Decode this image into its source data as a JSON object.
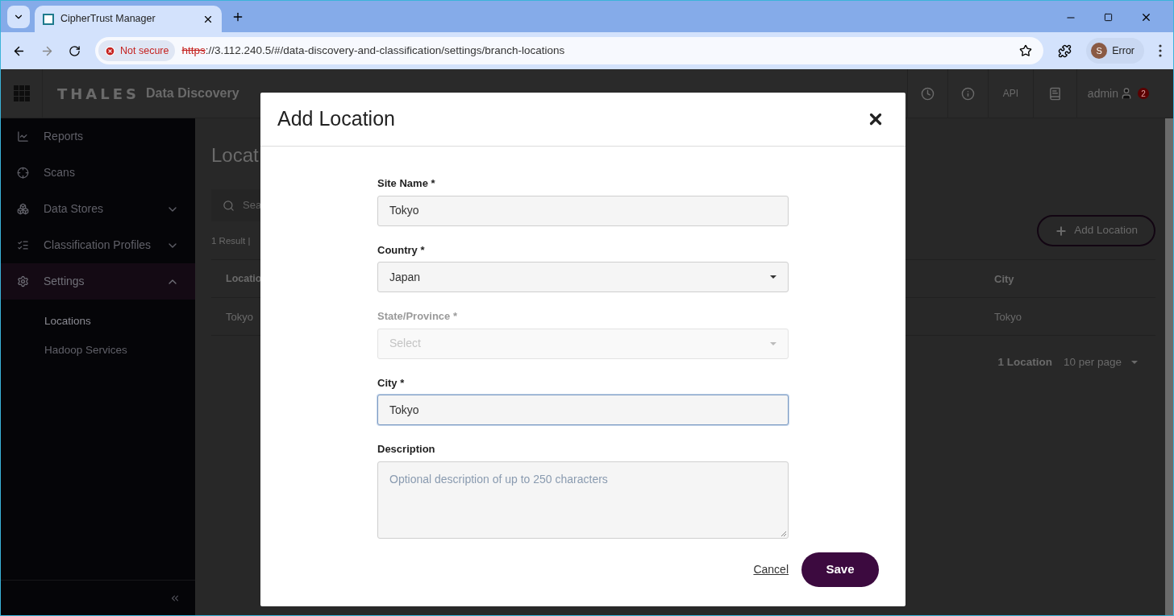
{
  "browser": {
    "tab_title": "CipherTrust Manager",
    "security": "Not secure",
    "url_scheme": "https",
    "url_rest": "://3.112.240.5/#/data-discovery-and-classification/settings/branch-locations",
    "profile_initial": "S",
    "profile_label": "Error"
  },
  "app": {
    "brand": "THALES",
    "product": "Data Discovery",
    "api_label": "API",
    "user": "admin",
    "notifications": "2"
  },
  "sidebar": {
    "items": [
      {
        "label": "Reports",
        "selected": false
      },
      {
        "label": "Scans",
        "selected": false
      },
      {
        "label": "Data Stores",
        "selected": false,
        "expanded": false
      },
      {
        "label": "Classification Profiles",
        "selected": false,
        "expanded": false
      },
      {
        "label": "Settings",
        "selected": true,
        "expanded": true,
        "children": [
          {
            "label": "Locations",
            "selected": true
          },
          {
            "label": "Hadoop Services",
            "selected": false
          }
        ]
      }
    ]
  },
  "main": {
    "title": "Locat",
    "search_placeholder": "Sea",
    "result_summary": "1 Result |",
    "add_button": "Add Location",
    "columns": [
      "Locatio",
      "City"
    ],
    "rows": [
      [
        "Tokyo",
        "Tokyo"
      ]
    ],
    "count": "1 Location",
    "per_page": "10 per page"
  },
  "modal": {
    "title": "Add Location",
    "fields": [
      {
        "kind": "text",
        "label": "Site Name *",
        "value": "Tokyo",
        "focused": false,
        "disabled": false
      },
      {
        "kind": "select",
        "label": "Country *",
        "value": "Japan",
        "focused": false,
        "disabled": false
      },
      {
        "kind": "select",
        "label": "State/Province *",
        "placeholder": "Select",
        "focused": false,
        "disabled": true
      },
      {
        "kind": "text",
        "label": "City *",
        "value": "Tokyo",
        "focused": true,
        "disabled": false
      },
      {
        "kind": "textarea",
        "label": "Description",
        "placeholder": "Optional description of up to 250 characters",
        "focused": false,
        "disabled": false
      }
    ],
    "cancel": "Cancel",
    "save": "Save"
  }
}
